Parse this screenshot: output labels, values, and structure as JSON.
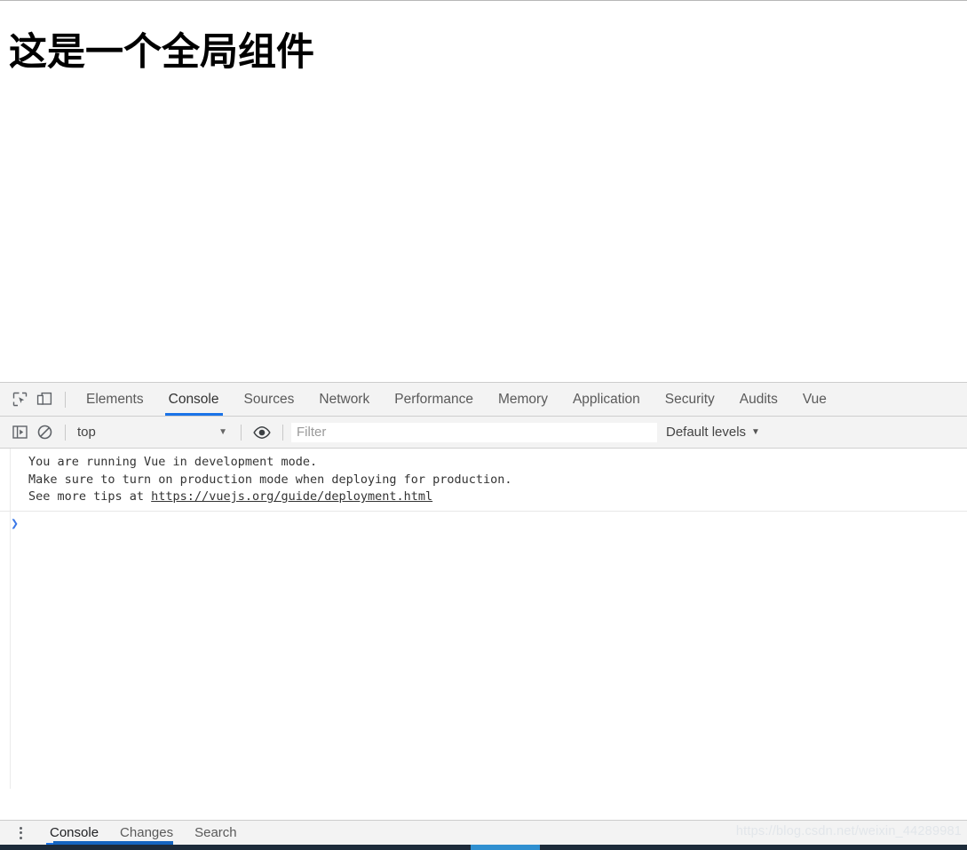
{
  "page": {
    "heading": "这是一个全局组件"
  },
  "devtools": {
    "toolbar": {
      "inspect_icon": "inspect-element-icon",
      "device_toolbar_icon": "device-toolbar-icon",
      "tabs": [
        {
          "label": "Elements",
          "active": false
        },
        {
          "label": "Console",
          "active": true
        },
        {
          "label": "Sources",
          "active": false
        },
        {
          "label": "Network",
          "active": false
        },
        {
          "label": "Performance",
          "active": false
        },
        {
          "label": "Memory",
          "active": false
        },
        {
          "label": "Application",
          "active": false
        },
        {
          "label": "Security",
          "active": false
        },
        {
          "label": "Audits",
          "active": false
        },
        {
          "label": "Vue",
          "active": false
        }
      ]
    },
    "filterbar": {
      "sidebar_toggle_icon": "console-sidebar-icon",
      "clear_console_icon": "clear-console-icon",
      "context_value": "top",
      "context_caret": "▼",
      "eye_icon": "eye-icon",
      "filter_placeholder": "Filter",
      "filter_value": "",
      "levels_label": "Default levels",
      "levels_caret": "▼"
    },
    "console": {
      "messages": [
        "You are running Vue in development mode.",
        "Make sure to turn on production mode when deploying for production.",
        "See more tips at "
      ],
      "link_text": "https://vuejs.org/guide/deployment.html",
      "prompt": "❯"
    },
    "drawer": {
      "menu_icon": "kebab-menu-icon",
      "tabs": [
        {
          "label": "Console",
          "active": true
        },
        {
          "label": "Changes",
          "active": false
        },
        {
          "label": "Search",
          "active": false
        }
      ]
    }
  },
  "watermark": {
    "text": "https://blog.csdn.net/weixin_44289981"
  },
  "colors": {
    "accent_blue": "#1a73e8",
    "prompt_blue": "#3b78e7",
    "toolbar_bg": "#f3f3f3",
    "taskbar": "#1d2b3a"
  }
}
